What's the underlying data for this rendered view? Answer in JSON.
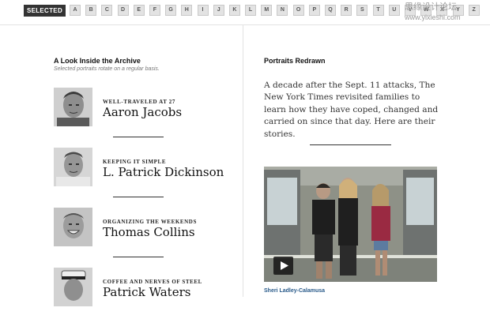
{
  "index_bar": {
    "selected_label": "SELECTED",
    "letters": [
      "A",
      "B",
      "C",
      "D",
      "E",
      "F",
      "G",
      "H",
      "I",
      "J",
      "K",
      "L",
      "M",
      "N",
      "O",
      "P",
      "Q",
      "R",
      "S",
      "T",
      "U",
      "V",
      "W",
      "X",
      "Y",
      "Z"
    ]
  },
  "watermark": {
    "text": "思缘设计论坛",
    "url": "www.yixieshi.com"
  },
  "archive": {
    "title": "A Look Inside the Archive",
    "subtitle": "Selected portraits rotate on a regular basis.",
    "entries": [
      {
        "kicker": "WELL-TRAVELED AT 27",
        "name": "Aaron Jacobs"
      },
      {
        "kicker": "KEEPING IT SIMPLE",
        "name": "L. Patrick Dickinson"
      },
      {
        "kicker": "ORGANIZING THE WEEKENDS",
        "name": "Thomas Collins"
      },
      {
        "kicker": "COFFEE AND NERVES OF STEEL",
        "name": "Patrick Waters"
      }
    ]
  },
  "portraits": {
    "title": "Portraits Redrawn",
    "body": "A decade after the Sept. 11 attacks, The New York Times revisited families to learn how they have coped, changed and carried on since that day. Here are their stories.",
    "video_caption": "Sheri Ladley-Calamusa"
  }
}
